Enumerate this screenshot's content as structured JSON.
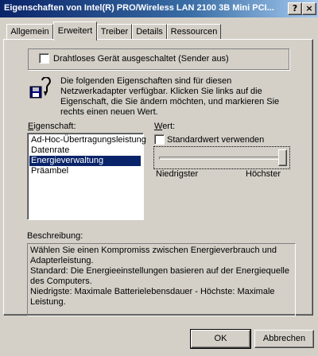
{
  "window": {
    "title": "Eigenschaften von Intel(R) PRO/Wireless LAN 2100 3B Mini PCI...",
    "help_glyph": "?",
    "close_glyph": "×"
  },
  "tabs": [
    {
      "label": "Allgemein"
    },
    {
      "label": "Erweitert"
    },
    {
      "label": "Treiber"
    },
    {
      "label": "Details"
    },
    {
      "label": "Ressourcen"
    }
  ],
  "radio_off": {
    "label": "Drahtloses Gerät ausgeschaltet (Sender aus)",
    "checked": false
  },
  "info_text": "Die folgenden Eigenschaften sind für diesen Netzwerkadapter verfügbar. Klicken Sie links auf die Eigenschaft, die Sie ändern möchten, und markieren Sie rechts einen neuen Wert.",
  "property": {
    "label": "Eigenschaft:",
    "items": [
      "Ad-Hoc-Übertragungsleistung",
      "Datenrate",
      "Energieverwaltung",
      "Präambel"
    ],
    "selected": "Energieverwaltung"
  },
  "value": {
    "label": "Wert:",
    "default_checkbox": "Standardwert verwenden",
    "default_checked": false,
    "slider_min_label": "Niedrigster",
    "slider_max_label": "Höchster",
    "slider_level": 1.0
  },
  "description": {
    "label": "Beschreibung:",
    "lines": [
      "Wählen Sie einen Kompromiss zwischen Energieverbrauch und",
      "Adapterleistung.",
      "Standard: Die Energieeinstellungen basieren auf der Energiequelle",
      "des Computers.",
      "Niedrigste: Maximale Batterielebensdauer - Höchste: Maximale",
      "Leistung."
    ]
  },
  "buttons": {
    "ok": "OK",
    "cancel": "Abbrechen"
  },
  "colors": {
    "title_start": "#0a246a",
    "title_end": "#a6caf0",
    "face": "#d4d0c8",
    "selection": "#0a246a"
  }
}
